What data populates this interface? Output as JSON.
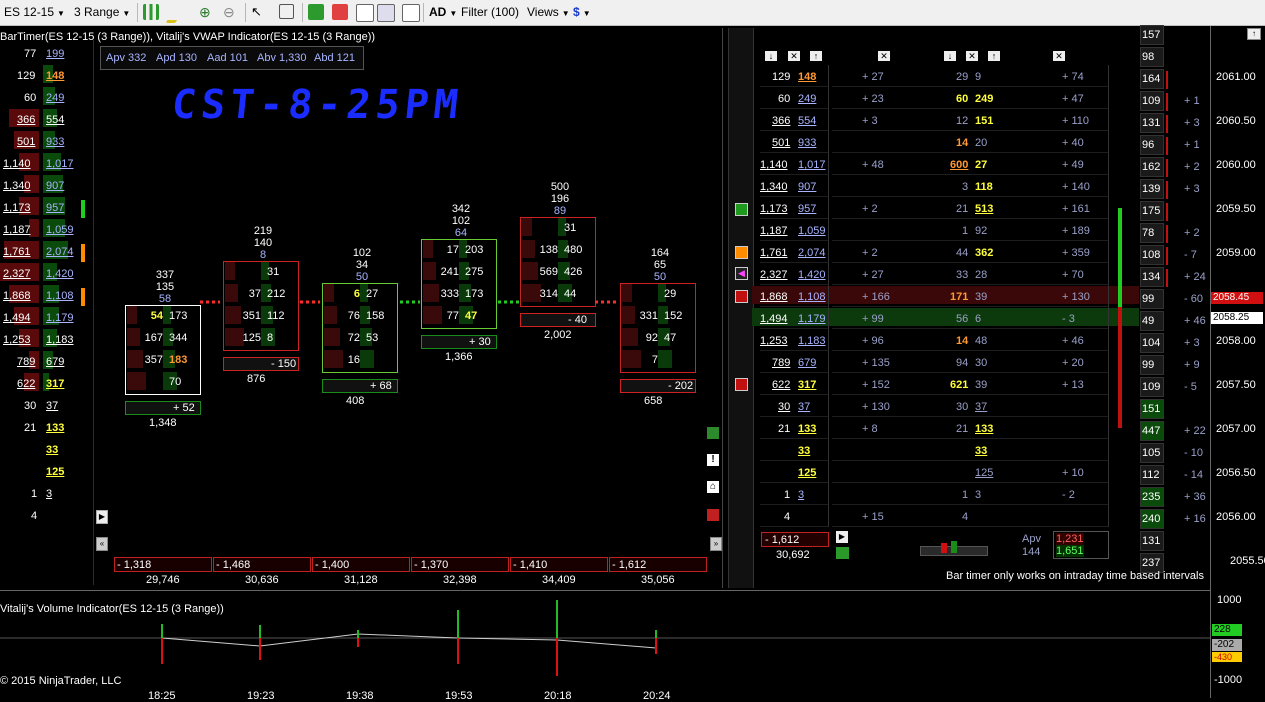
{
  "toolbar": {
    "instrument": "ES 12-15",
    "period": "3 Range",
    "filter": "Filter (100)",
    "views": "Views"
  },
  "chart_title": "BarTimer(ES 12-15 (3 Range)), Vitalij's VWAP Indicator(ES 12-15 (3 Range))",
  "stats": {
    "apv": "Apv 332",
    "apd": "Apd 130",
    "aad": "Aad 101",
    "abv": "Abv 1,330",
    "abd": "Abd 121"
  },
  "annotation": "CST-8-25PM",
  "left_ladder": [
    {
      "bid": "77",
      "ask": "199",
      "askc": "lb"
    },
    {
      "bid": "129",
      "ask": "148",
      "askc": "org"
    },
    {
      "bid": "60",
      "ask": "249",
      "askc": "lb"
    },
    {
      "bid": "366",
      "ask": "554",
      "askc": "w"
    },
    {
      "bid": "501",
      "ask": "933",
      "askc": "lb"
    },
    {
      "bid": "1,140",
      "ask": "1,017",
      "askc": "lb"
    },
    {
      "bid": "1,340",
      "ask": "907",
      "askc": "lb"
    },
    {
      "bid": "1,173",
      "ask": "957",
      "askc": "lb"
    },
    {
      "bid": "1,187",
      "ask": "1,059",
      "askc": "lb"
    },
    {
      "bid": "1,761",
      "ask": "2,074",
      "askc": "lb"
    },
    {
      "bid": "2,327",
      "ask": "1,420",
      "askc": "lb"
    },
    {
      "bid": "1,868",
      "ask": "1,108",
      "askc": "lb"
    },
    {
      "bid": "1,494",
      "ask": "1,179",
      "askc": "lb"
    },
    {
      "bid": "1,253",
      "ask": "1,183",
      "askc": "w"
    },
    {
      "bid": "789",
      "ask": "679",
      "askc": "w"
    },
    {
      "bid": "622",
      "ask": "317",
      "askc": "yel"
    },
    {
      "bid": "30",
      "ask": "37",
      "askc": "w"
    },
    {
      "bid": "21",
      "ask": "133",
      "askc": "yel"
    },
    {
      "bid": "",
      "ask": "33",
      "askc": "yel"
    },
    {
      "bid": "",
      "ask": "125",
      "askc": "yel"
    },
    {
      "bid": "1",
      "ask": "3",
      "askc": "w"
    },
    {
      "bid": "4",
      "ask": "",
      "askc": "w"
    }
  ],
  "footprints": [
    {
      "top": [
        "337",
        "135",
        "58"
      ],
      "rows": [
        [
          "54",
          "173"
        ],
        [
          "167",
          "344"
        ],
        [
          "357",
          "183"
        ],
        [
          "",
          "70"
        ]
      ],
      "delta": "+ 52",
      "vol": "1,348"
    },
    {
      "top": [
        "219",
        "140",
        "8"
      ],
      "rows": [
        [
          "",
          "31"
        ],
        [
          "37",
          "212"
        ],
        [
          "351",
          "112"
        ],
        [
          "125",
          "8"
        ]
      ],
      "delta": "- 150",
      "vol": "876"
    },
    {
      "top": [
        "102",
        "34",
        "50"
      ],
      "rows": [
        [
          "6",
          "27"
        ],
        [
          "76",
          "158"
        ],
        [
          "72",
          "53"
        ],
        [
          "16",
          ""
        ]
      ],
      "delta": "+ 68",
      "vol": "408"
    },
    {
      "top": [
        "342",
        "102",
        "64"
      ],
      "rows": [
        [
          "17",
          "203"
        ],
        [
          "241",
          "275"
        ],
        [
          "333",
          "173"
        ],
        [
          "77",
          "47"
        ]
      ],
      "delta": "+ 30",
      "vol": "1,366"
    },
    {
      "top": [
        "500",
        "196",
        "89"
      ],
      "rows": [
        [
          "",
          "31"
        ],
        [
          "138",
          "480"
        ],
        [
          "569",
          "426"
        ],
        [
          "314",
          "44"
        ]
      ],
      "delta": "- 40",
      "vol": "2,002"
    },
    {
      "top": [
        "164",
        "65",
        "50"
      ],
      "rows": [
        [
          "",
          "29"
        ],
        [
          "331",
          "152"
        ],
        [
          "92",
          "47"
        ],
        [
          "7",
          ""
        ]
      ],
      "delta": "- 202",
      "vol": "658"
    }
  ],
  "bottom_deltas": [
    {
      "d": "- 1,318",
      "v": "29,746"
    },
    {
      "d": "- 1,468",
      "v": "30,636"
    },
    {
      "d": "- 1,400",
      "v": "31,128"
    },
    {
      "d": "- 1,370",
      "v": "32,398"
    },
    {
      "d": "- 1,410",
      "v": "34,409"
    },
    {
      "d": "- 1,612",
      "v": "35,056"
    }
  ],
  "right_ladder": [
    {
      "b": "129",
      "a": "148",
      "pd": "+ 27",
      "m": "29",
      "x": "9",
      "r": "+ 74",
      "p": "2061.00"
    },
    {
      "b": "60",
      "a": "249",
      "pd": "+ 23",
      "m": "60",
      "x": "249",
      "r": "+ 47",
      "p": ""
    },
    {
      "b": "366",
      "a": "554",
      "pd": "+ 3",
      "m": "12",
      "x": "151",
      "r": "+ 110",
      "p": "2060.50"
    },
    {
      "b": "501",
      "a": "933",
      "pd": "",
      "m": "14",
      "x": "20",
      "r": "+ 40",
      "p": ""
    },
    {
      "b": "1,140",
      "a": "1,017",
      "pd": "+ 48",
      "m": "600",
      "x": "27",
      "r": "+ 49",
      "p": "2060.00"
    },
    {
      "b": "1,340",
      "a": "907",
      "pd": "",
      "m": "3",
      "x": "118",
      "r": "+ 140",
      "p": ""
    },
    {
      "b": "1,173",
      "a": "957",
      "pd": "+ 2",
      "m": "21",
      "x": "513",
      "r": "+ 161",
      "p": "2059.50"
    },
    {
      "b": "1,187",
      "a": "1,059",
      "pd": "",
      "m": "1",
      "x": "92",
      "r": "+ 189",
      "p": ""
    },
    {
      "b": "1,761",
      "a": "2,074",
      "pd": "+ 2",
      "m": "44",
      "x": "362",
      "r": "+ 359",
      "p": "2059.00"
    },
    {
      "b": "2,327",
      "a": "1,420",
      "pd": "+ 27",
      "m": "33",
      "x": "28",
      "r": "+ 70",
      "p": ""
    },
    {
      "b": "1,868",
      "a": "1,108",
      "pd": "+ 166",
      "m": "171",
      "x": "39",
      "r": "+ 130",
      "p": ""
    },
    {
      "b": "1,494",
      "a": "1,179",
      "pd": "+ 99",
      "m": "56",
      "x": "6",
      "r": "- 3",
      "p": ""
    },
    {
      "b": "1,253",
      "a": "1,183",
      "pd": "+ 96",
      "m": "14",
      "x": "48",
      "r": "+ 46",
      "p": "2058.00"
    },
    {
      "b": "789",
      "a": "679",
      "pd": "+ 135",
      "m": "94",
      "x": "30",
      "r": "+ 20",
      "p": ""
    },
    {
      "b": "622",
      "a": "317",
      "pd": "+ 152",
      "m": "621",
      "x": "39",
      "r": "+ 13",
      "p": "2057.50"
    },
    {
      "b": "30",
      "a": "37",
      "pd": "+ 130",
      "m": "30",
      "x": "37",
      "r": "",
      "p": ""
    },
    {
      "b": "21",
      "a": "133",
      "pd": "+ 8",
      "m": "21",
      "x": "133",
      "r": "",
      "p": "2057.00"
    },
    {
      "b": "",
      "a": "33",
      "pd": "",
      "m": "",
      "x": "33",
      "r": "",
      "p": ""
    },
    {
      "b": "",
      "a": "125",
      "pd": "",
      "m": "",
      "x": "125",
      "r": "+ 10",
      "p": "2056.50"
    },
    {
      "b": "1",
      "a": "3",
      "pd": "",
      "m": "1",
      "x": "3",
      "r": "- 2",
      "p": ""
    },
    {
      "b": "4",
      "a": "",
      "pd": "+ 15",
      "m": "4",
      "x": "",
      "r": "",
      "p": "2056.00"
    }
  ],
  "far_right": [
    {
      "v": "157",
      "d": ""
    },
    {
      "v": "98",
      "d": ""
    },
    {
      "v": "164",
      "d": ""
    },
    {
      "v": "109",
      "d": "+ 1"
    },
    {
      "v": "131",
      "d": "+ 3"
    },
    {
      "v": "96",
      "d": "+ 1"
    },
    {
      "v": "162",
      "d": "+ 2"
    },
    {
      "v": "139",
      "d": "+ 3"
    },
    {
      "v": "175",
      "d": ""
    },
    {
      "v": "78",
      "d": "+ 2"
    },
    {
      "v": "108",
      "d": "- 7"
    },
    {
      "v": "134",
      "d": "+ 24"
    },
    {
      "v": "99",
      "d": "- 60"
    },
    {
      "v": "49",
      "d": "+ 46"
    },
    {
      "v": "104",
      "d": "+ 3"
    },
    {
      "v": "99",
      "d": "+ 9"
    },
    {
      "v": "109",
      "d": "- 5"
    },
    {
      "v": "151",
      "d": ""
    },
    {
      "v": "447",
      "d": "+ 22"
    },
    {
      "v": "105",
      "d": "- 10"
    },
    {
      "v": "112",
      "d": "- 14"
    },
    {
      "v": "235",
      "d": "+ 36"
    },
    {
      "v": "240",
      "d": "+ 16"
    },
    {
      "v": "131",
      "d": ""
    },
    {
      "v": "237",
      "d": ""
    }
  ],
  "price_tags": {
    "last": "2058.45",
    "bid": "2058.25",
    "extra": "2055.50"
  },
  "summary": {
    "delta": "- 1,612",
    "total": "30,692",
    "apv_label": "Apv",
    "apv_val": "1,231",
    "apv_count": "144",
    "apv_val2": "1,651"
  },
  "bartimer_msg": "Bar timer only works on intraday time based intervals",
  "volume_panel": {
    "title": "Vitalij's Volume Indicator(ES 12-15 (3 Range))",
    "axis": [
      "1000",
      "-1000"
    ],
    "tags": [
      "228",
      "-202",
      "-430"
    ]
  },
  "time_labels": [
    "18:25",
    "19:23",
    "19:38",
    "19:53",
    "20:18",
    "20:24"
  ],
  "copyright": "© 2015 NinjaTrader, LLC",
  "colors": {
    "bg": "#000000",
    "up": "#1a8c1a",
    "down": "#b01010",
    "accent": "#ffff3c"
  }
}
